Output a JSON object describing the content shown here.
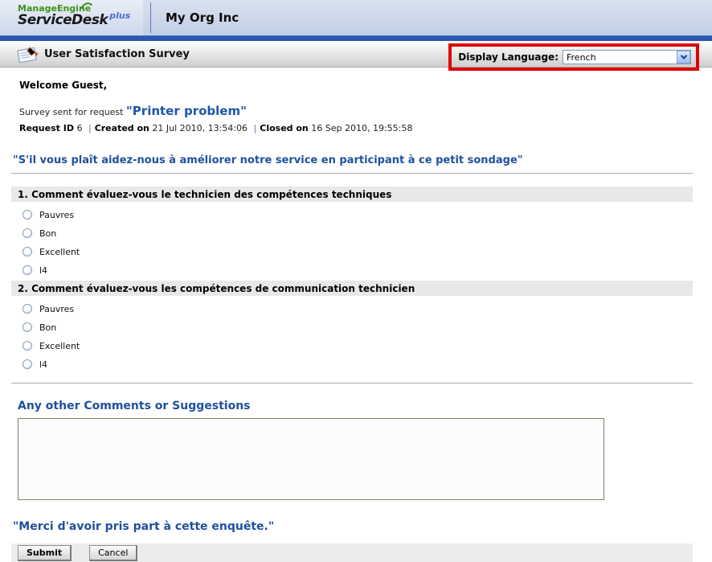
{
  "header": {
    "logo": {
      "brand": "ManageEngine",
      "product": "ServiceDesk",
      "plus": "plus"
    },
    "org_name": "My Org Inc"
  },
  "title_bar": {
    "title": "User Satisfaction Survey",
    "display_language_label": "Display Language:",
    "language_selected": "French"
  },
  "survey": {
    "welcome": "Welcome Guest,",
    "sent_for_prefix": "Survey sent for request ",
    "request_name_quoted": "\"Printer problem\"",
    "meta": {
      "request_id_label": "Request ID",
      "request_id": " 6 ",
      "separator": "|",
      "created_label": "Created on",
      "created": " 21 Jul 2010, 13:54:06 ",
      "closed_label": "Closed on",
      "closed": " 16 Sep 2010, 19:55:58"
    },
    "intro_quote": "\"S'il vous plaît aidez-nous à améliorer notre service en participant à ce petit sondage\"",
    "questions": [
      {
        "label": "1. Comment évaluez-vous le technicien des compétences techniques",
        "options": [
          "Pauvres",
          "Bon",
          "Excellent",
          "l4"
        ]
      },
      {
        "label": "2. Comment évaluez-vous les compétences de communication technicien",
        "options": [
          "Pauvres",
          "Bon",
          "Excellent",
          "l4"
        ]
      }
    ],
    "comments_heading": "Any other Comments or Suggestions",
    "comments_value": "",
    "thanks_quote": "\"Merci d'avoir pris part à cette enquête.\"",
    "buttons": {
      "submit": "Submit",
      "cancel": "Cancel"
    }
  },
  "colors": {
    "accent_blue_text": "#1f509e",
    "header_blue_bar": "#2a57b0",
    "annotation_red": "#e00000",
    "question_bar_bg": "#e8e8e8",
    "logo_green": "#3d9419"
  }
}
